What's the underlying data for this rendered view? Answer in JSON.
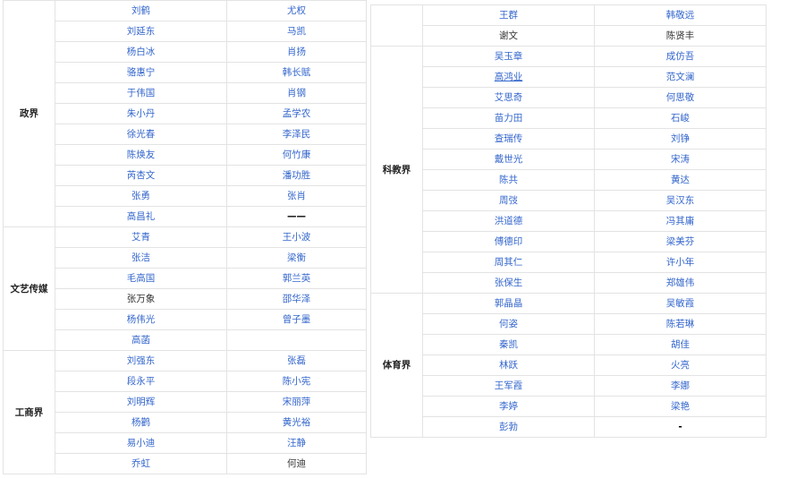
{
  "left_table": {
    "groups": [
      {
        "category": "政界",
        "rows": [
          [
            {
              "t": "刘鹤",
              "c": "link"
            },
            {
              "t": "尤权",
              "c": "link"
            }
          ],
          [
            {
              "t": "刘延东",
              "c": "link"
            },
            {
              "t": "马凯",
              "c": "link"
            }
          ],
          [
            {
              "t": "杨白冰",
              "c": "link"
            },
            {
              "t": "肖扬",
              "c": "link"
            }
          ],
          [
            {
              "t": "骆惠宁",
              "c": "link"
            },
            {
              "t": "韩长赋",
              "c": "link"
            }
          ],
          [
            {
              "t": "于伟国",
              "c": "link"
            },
            {
              "t": "肖钢",
              "c": "link"
            }
          ],
          [
            {
              "t": "朱小丹",
              "c": "link"
            },
            {
              "t": "孟学农",
              "c": "link"
            }
          ],
          [
            {
              "t": "徐光春",
              "c": "link"
            },
            {
              "t": "李泽民",
              "c": "link"
            }
          ],
          [
            {
              "t": "陈焕友",
              "c": "link"
            },
            {
              "t": "何竹康",
              "c": "link"
            }
          ],
          [
            {
              "t": "芮杏文",
              "c": "link"
            },
            {
              "t": "潘功胜",
              "c": "link"
            }
          ],
          [
            {
              "t": "张勇",
              "c": "link"
            },
            {
              "t": "张肖",
              "c": "link"
            }
          ],
          [
            {
              "t": "高昌礼",
              "c": "link"
            },
            {
              "t": "——",
              "c": "dash"
            }
          ]
        ]
      },
      {
        "category": "文艺传媒",
        "rows": [
          [
            {
              "t": "艾青",
              "c": "link"
            },
            {
              "t": "王小波",
              "c": "link"
            }
          ],
          [
            {
              "t": "张洁",
              "c": "link"
            },
            {
              "t": "梁衡",
              "c": "link"
            }
          ],
          [
            {
              "t": "毛高国",
              "c": "link"
            },
            {
              "t": "郭兰英",
              "c": "link"
            }
          ],
          [
            {
              "t": "张万象",
              "c": "plain"
            },
            {
              "t": "邵华泽",
              "c": "link"
            }
          ],
          [
            {
              "t": "杨伟光",
              "c": "link"
            },
            {
              "t": "曾子墨",
              "c": "link"
            }
          ],
          [
            {
              "t": "高菡",
              "c": "link"
            },
            {
              "t": "",
              "c": "plain"
            }
          ]
        ]
      },
      {
        "category": "工商界",
        "rows": [
          [
            {
              "t": "刘强东",
              "c": "link"
            },
            {
              "t": "张磊",
              "c": "link"
            }
          ],
          [
            {
              "t": "段永平",
              "c": "link"
            },
            {
              "t": "陈小宪",
              "c": "link"
            }
          ],
          [
            {
              "t": "刘明辉",
              "c": "link"
            },
            {
              "t": "宋丽萍",
              "c": "link"
            }
          ],
          [
            {
              "t": "杨鹳",
              "c": "link"
            },
            {
              "t": "黄光裕",
              "c": "link"
            }
          ],
          [
            {
              "t": "易小迪",
              "c": "link"
            },
            {
              "t": "汪静",
              "c": "link"
            }
          ],
          [
            {
              "t": "乔虹",
              "c": "link"
            },
            {
              "t": "何迪",
              "c": "plain"
            }
          ]
        ]
      }
    ]
  },
  "right_table": {
    "groups": [
      {
        "category": "",
        "rows": [
          [
            {
              "t": "王群",
              "c": "link"
            },
            {
              "t": "韩敬远",
              "c": "link"
            }
          ],
          [
            {
              "t": "谢文",
              "c": "plain"
            },
            {
              "t": "陈贤丰",
              "c": "plain"
            }
          ]
        ]
      },
      {
        "category": "科教界",
        "rows": [
          [
            {
              "t": "吴玉章",
              "c": "link"
            },
            {
              "t": "成仿吾",
              "c": "link"
            }
          ],
          [
            {
              "t": "高鸿业",
              "c": "link ul"
            },
            {
              "t": "范文澜",
              "c": "link"
            }
          ],
          [
            {
              "t": "艾思奇",
              "c": "link"
            },
            {
              "t": "何思敬",
              "c": "link"
            }
          ],
          [
            {
              "t": "苗力田",
              "c": "link"
            },
            {
              "t": "石峻",
              "c": "link"
            }
          ],
          [
            {
              "t": "查瑞传",
              "c": "link"
            },
            {
              "t": "刘铮",
              "c": "link"
            }
          ],
          [
            {
              "t": "戴世光",
              "c": "link"
            },
            {
              "t": "宋涛",
              "c": "link"
            }
          ],
          [
            {
              "t": "陈共",
              "c": "link"
            },
            {
              "t": "黄达",
              "c": "link"
            }
          ],
          [
            {
              "t": "周弢",
              "c": "link"
            },
            {
              "t": "吴汉东",
              "c": "link"
            }
          ],
          [
            {
              "t": "洪道德",
              "c": "link"
            },
            {
              "t": "冯其庸",
              "c": "link"
            }
          ],
          [
            {
              "t": "傅德印",
              "c": "link"
            },
            {
              "t": "梁美芬",
              "c": "link"
            }
          ],
          [
            {
              "t": "周其仁",
              "c": "link"
            },
            {
              "t": "许小年",
              "c": "link"
            }
          ],
          [
            {
              "t": "张保生",
              "c": "link"
            },
            {
              "t": "郑雄伟",
              "c": "link"
            }
          ]
        ]
      },
      {
        "category": "体育界",
        "rows": [
          [
            {
              "t": "郭晶晶",
              "c": "link"
            },
            {
              "t": "吴敏霞",
              "c": "link"
            }
          ],
          [
            {
              "t": "何姿",
              "c": "link"
            },
            {
              "t": "陈若琳",
              "c": "link"
            }
          ],
          [
            {
              "t": "秦凯",
              "c": "link"
            },
            {
              "t": "胡佳",
              "c": "link"
            }
          ],
          [
            {
              "t": "林跃",
              "c": "link"
            },
            {
              "t": "火亮",
              "c": "link"
            }
          ],
          [
            {
              "t": "王军霞",
              "c": "link"
            },
            {
              "t": "李娜",
              "c": "link"
            }
          ],
          [
            {
              "t": "李婷",
              "c": "link"
            },
            {
              "t": "梁艳",
              "c": "link"
            }
          ],
          [
            {
              "t": "彭勃",
              "c": "link"
            },
            {
              "t": "-",
              "c": "dash"
            }
          ]
        ]
      }
    ]
  }
}
